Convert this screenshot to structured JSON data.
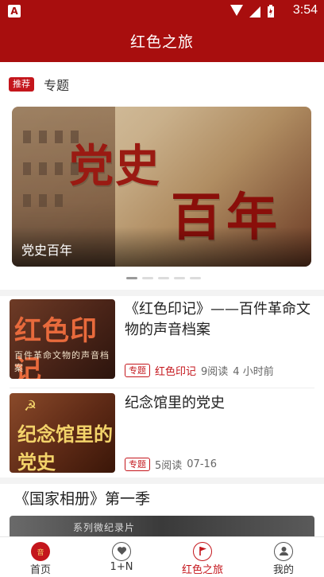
{
  "status_bar": {
    "app_badge": "A",
    "time": "3:54"
  },
  "app_bar": {
    "title": "红色之旅"
  },
  "section": {
    "tag": "推荐",
    "title": "专题"
  },
  "banner": {
    "art_text_1": "党史",
    "art_text_2": "百年",
    "caption": "党史百年",
    "dots_count": 5,
    "active_dot": 0
  },
  "items": [
    {
      "thumb_text": "红色印记",
      "thumb_sub": "百件革命文物的声音档案",
      "title": "《红色印记》——百件革命文物的声音档案",
      "chip": "专题",
      "column": "红色印记",
      "reads": "9阅读",
      "time": "4 小时前"
    },
    {
      "thumb_text": "纪念馆里的党史",
      "title": "纪念馆里的党史",
      "chip": "专题",
      "reads": "5阅读",
      "time": "07-16"
    }
  ],
  "album": {
    "title": "《国家相册》第一季",
    "thumb_text": "系列微纪录片"
  },
  "bottom_nav": [
    {
      "label": "首页",
      "icon": "home-logo-icon"
    },
    {
      "label": "1+N",
      "icon": "heart-circle-icon"
    },
    {
      "label": "红色之旅",
      "icon": "flag-circle-icon",
      "active": true
    },
    {
      "label": "我的",
      "icon": "user-circle-icon"
    }
  ],
  "colors": {
    "primary": "#a80e0e",
    "accent": "#c4161c"
  }
}
